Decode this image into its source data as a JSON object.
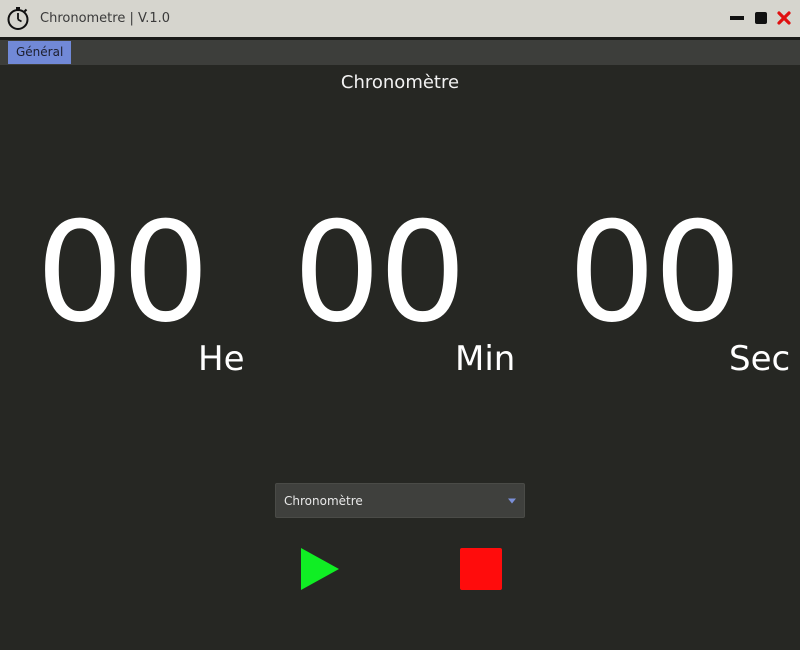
{
  "window": {
    "title": "Chronometre | V.1.0"
  },
  "menu": {
    "items": [
      {
        "label": "Général",
        "active": true
      }
    ]
  },
  "main": {
    "heading": "Chronomètre",
    "time": {
      "hours": "00",
      "minutes": "00",
      "seconds": "00",
      "hours_label": "He",
      "minutes_label": "Min",
      "seconds_label": "Sec"
    },
    "mode": {
      "selected": "Chronomètre"
    },
    "controls": {
      "play_icon": "play-icon",
      "stop_icon": "stop-icon"
    }
  },
  "colors": {
    "background": "#262723",
    "titlebar": "#d6d5ce",
    "menubar": "#3d3e3b",
    "menu_active": "#7189d7",
    "play": "#10ee24",
    "stop": "#ff0c0c",
    "close": "#e01010",
    "dropdown_arrow": "#7b8fd8"
  }
}
